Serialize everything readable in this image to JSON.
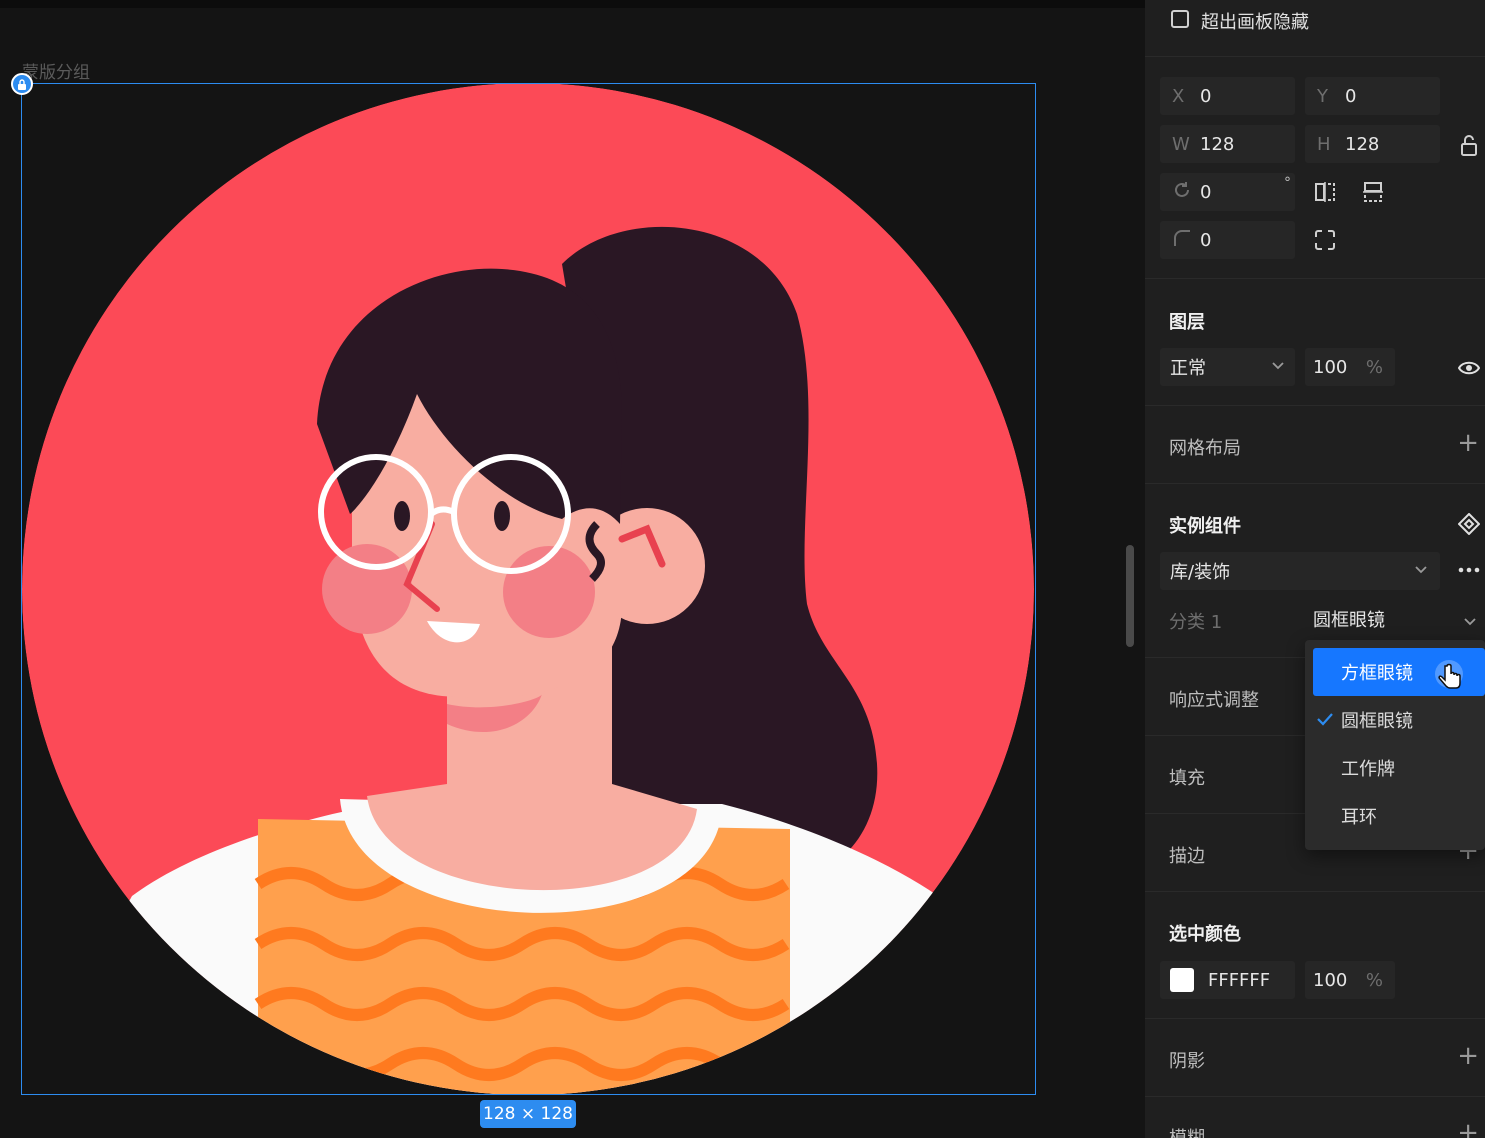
{
  "canvas": {
    "group_label": "蒙版分组",
    "size_badge": "128 × 128"
  },
  "panel": {
    "clip_checkbox": {
      "label": "超出画板隐藏",
      "checked": false
    },
    "transform": {
      "x_label": "X",
      "x_value": "0",
      "y_label": "Y",
      "y_value": "0",
      "w_label": "W",
      "w_value": "128",
      "h_label": "H",
      "h_value": "128",
      "rotation_value": "0",
      "rotation_unit": "°",
      "radius_value": "0"
    },
    "layer": {
      "title": "图层",
      "blend_mode": "正常",
      "opacity_value": "100",
      "opacity_unit": "%"
    },
    "grid": {
      "title": "网格布局"
    },
    "instance": {
      "title": "实例组件",
      "library_value": "库/装饰",
      "property_label": "分类 1",
      "property_value": "圆框眼镜"
    },
    "responsive": {
      "title": "响应式调整"
    },
    "fill": {
      "title": "填充"
    },
    "stroke": {
      "title": "描边"
    },
    "selection_color": {
      "title": "选中颜色",
      "hex": "FFFFFF",
      "opacity": "100",
      "unit": "%",
      "swatch_color": "#FFFFFF"
    },
    "shadow": {
      "title": "阴影"
    },
    "blur": {
      "title": "模糊"
    }
  },
  "dropdown": {
    "items": [
      "方框眼镜",
      "圆框眼镜",
      "工作牌",
      "耳环"
    ],
    "hovered_index": 0,
    "selected_index": 1
  },
  "colors": {
    "accent": "#1677FF",
    "selection_blue": "#2D8CF0",
    "avatar_bg": "#FC4A57",
    "hair": "#2A1724",
    "skin": "#F8ADA1",
    "shirt": "#FFA04D"
  }
}
